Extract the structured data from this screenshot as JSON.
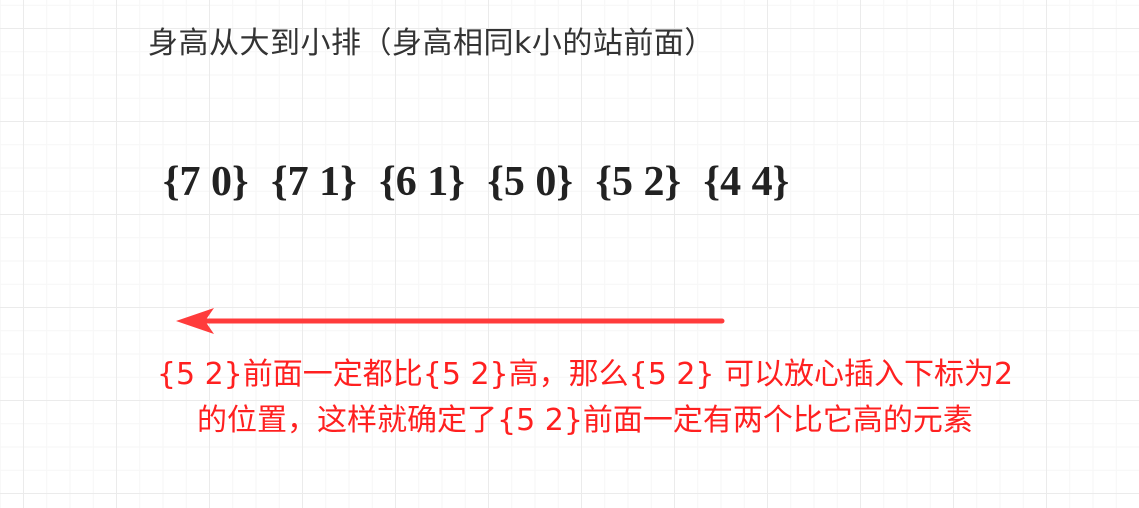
{
  "title": "身高从大到小排（身高相同k小的站前面）",
  "sequence": [
    "{7 0}",
    "{7 1}",
    "{6 1}",
    "{5 0}",
    "{5 2}",
    "{4 4}"
  ],
  "arrow_color": "#ff3b3b",
  "note": {
    "line1": "{5 2}前面一定都比{5 2}高，那么{5 2} 可以放心插入下标为2",
    "line2": "的位置，这样就确定了{5 2}前面一定有两个比它高的元素"
  },
  "colors": {
    "note": "#ff2020",
    "title": "#333333"
  }
}
